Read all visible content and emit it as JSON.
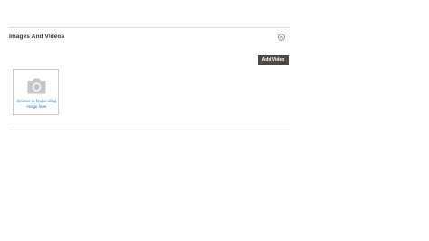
{
  "section": {
    "title": "Images And Videos",
    "toggle_icon": "collapse-circle-icon"
  },
  "toolbar": {
    "add_video_label": "Add Video"
  },
  "uploader": {
    "icon": "camera-icon",
    "text": "Browse to find or drag image here"
  },
  "colors": {
    "button_bg": "#514943",
    "link": "#1979c3",
    "icon_gray": "#c5c5c5",
    "divider": "#dcdcdc"
  }
}
